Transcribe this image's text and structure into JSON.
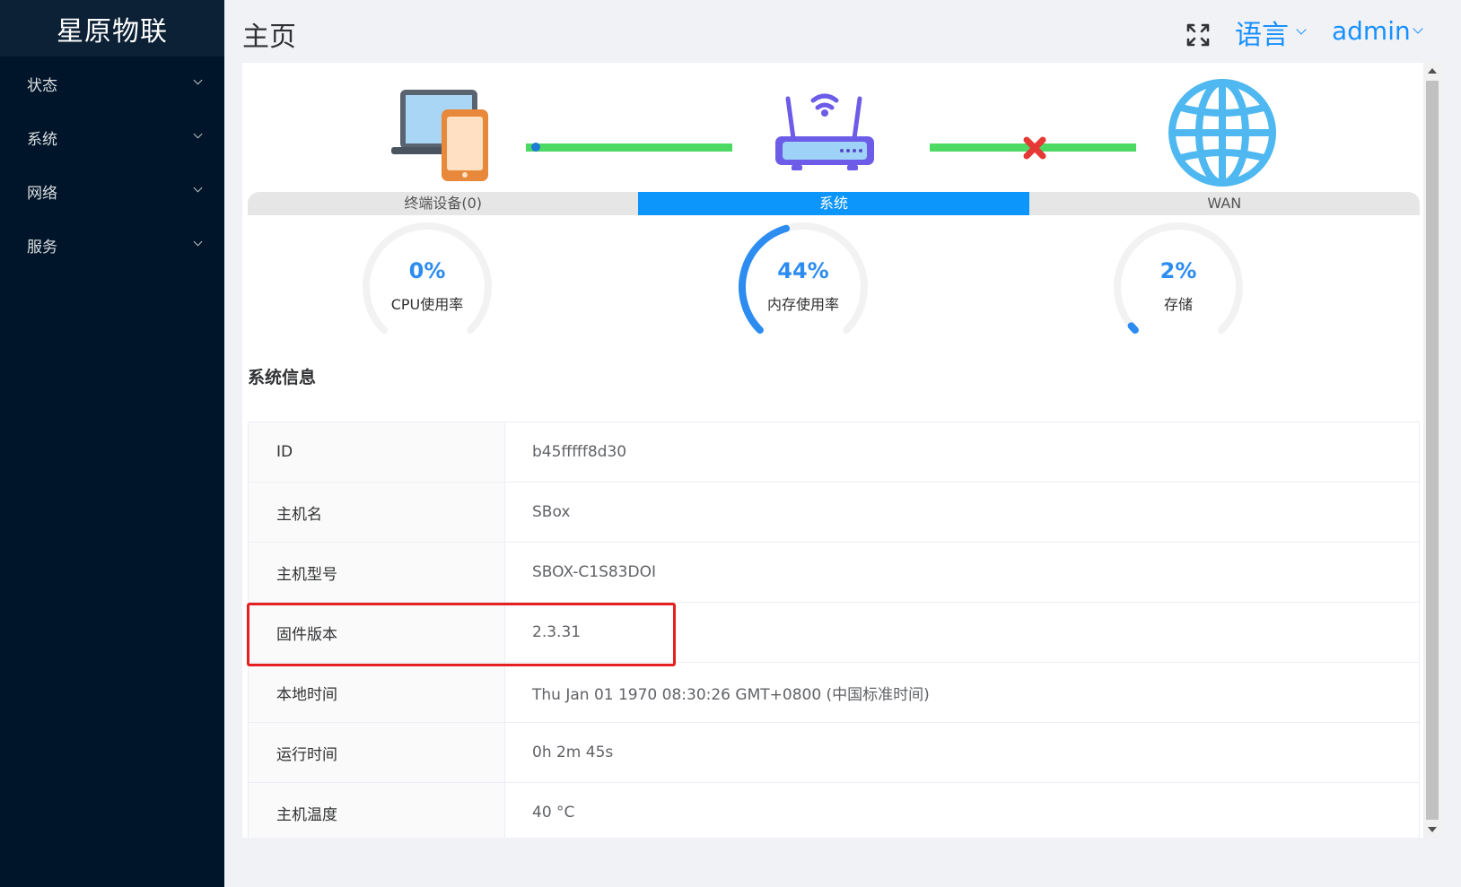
{
  "sidebar": {
    "brand": "星原物联",
    "items": [
      {
        "label": "状态"
      },
      {
        "label": "系统"
      },
      {
        "label": "网络"
      },
      {
        "label": "服务"
      }
    ]
  },
  "header": {
    "title": "主页",
    "language_label": "语言",
    "user_label": "admin"
  },
  "topology": {
    "tabs": [
      "终端设备(0)",
      "系统",
      "WAN"
    ],
    "active_tab": "系统",
    "wan_status": "disconnected",
    "link_color": "#4cd964",
    "error_color": "#e53935"
  },
  "gauges": [
    {
      "value": "0%",
      "label": "CPU使用率",
      "percent": 0
    },
    {
      "value": "44%",
      "label": "内存使用率",
      "percent": 44
    },
    {
      "value": "2%",
      "label": "存储",
      "percent": 2
    }
  ],
  "system_info": {
    "title": "系统信息",
    "rows": [
      {
        "key": "ID",
        "value": "b45fffff8d30"
      },
      {
        "key": "主机名",
        "value": "SBox"
      },
      {
        "key": "主机型号",
        "value": "SBOX-C1S83DOI"
      },
      {
        "key": "固件版本",
        "value": "2.3.31"
      },
      {
        "key": "本地时间",
        "value": "Thu Jan 01 1970 08:30:26 GMT+0800 (中国标准时间)"
      },
      {
        "key": "运行时间",
        "value": "0h 2m 45s"
      },
      {
        "key": "主机温度",
        "value": "40 °C"
      }
    ]
  },
  "colors": {
    "sidebar_bg": "#001529",
    "accent": "#1890ff",
    "gauge_fill": "#2d8cf0",
    "highlight_border": "#e62020"
  }
}
